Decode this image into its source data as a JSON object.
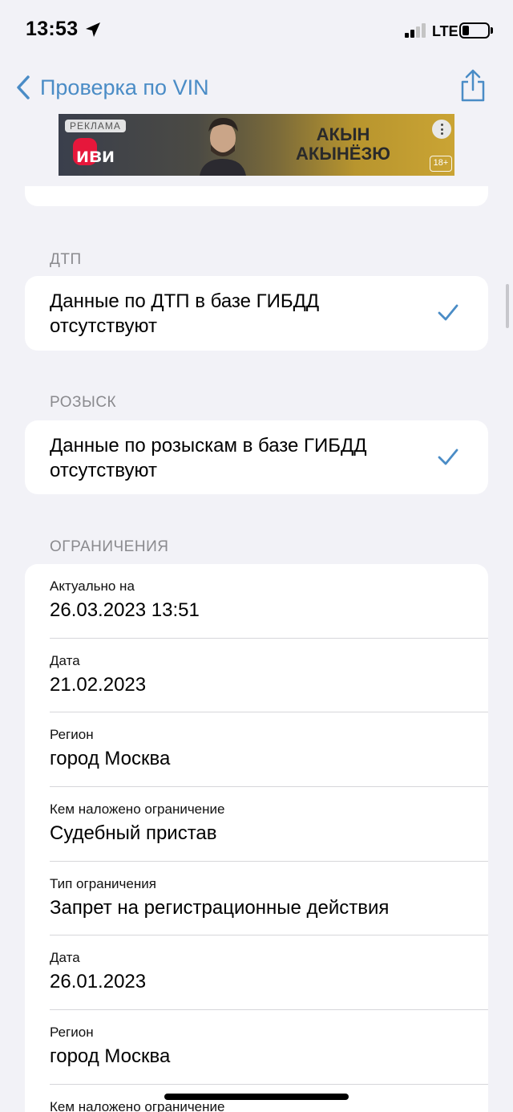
{
  "status_bar": {
    "time": "13:53",
    "network": "LTE",
    "battery_level": 0.2
  },
  "nav": {
    "back_label": "Проверка по VIN"
  },
  "ad": {
    "label": "РЕКЛАМА",
    "brand": "иви",
    "text_line1": "АКЫН",
    "text_line2": "АКЫНЁЗЮ",
    "age_rating": "18+"
  },
  "sections": {
    "dtp": {
      "header": "ДТП",
      "text": "Данные по ДТП в базе ГИБДД отсутствуют"
    },
    "wanted": {
      "header": "РОЗЫСК",
      "text": "Данные по розыскам в базе ГИБДД отсутствуют"
    },
    "restrictions": {
      "header": "ОГРАНИЧЕНИЯ",
      "rows": [
        {
          "label": "Актуально на",
          "value": "26.03.2023 13:51"
        },
        {
          "label": "Дата",
          "value": "21.02.2023"
        },
        {
          "label": "Регион",
          "value": "город Москва"
        },
        {
          "label": "Кем наложено ограничение",
          "value": "Судебный пристав"
        },
        {
          "label": "Тип ограничения",
          "value": "Запрет на регистрационные действия"
        },
        {
          "label": "Дата",
          "value": "26.01.2023"
        },
        {
          "label": "Регион",
          "value": "город Москва"
        },
        {
          "label": "Кем наложено ограничение",
          "value": ""
        }
      ]
    }
  },
  "colors": {
    "accent": "#4a8cc6",
    "background": "#f2f2f7",
    "card": "#ffffff",
    "secondary_text": "#8a8a8e"
  },
  "icons": [
    "location-arrow-icon",
    "signal-icon",
    "battery-icon",
    "chevron-left-icon",
    "share-icon",
    "checkmark-icon",
    "more-icon"
  ]
}
